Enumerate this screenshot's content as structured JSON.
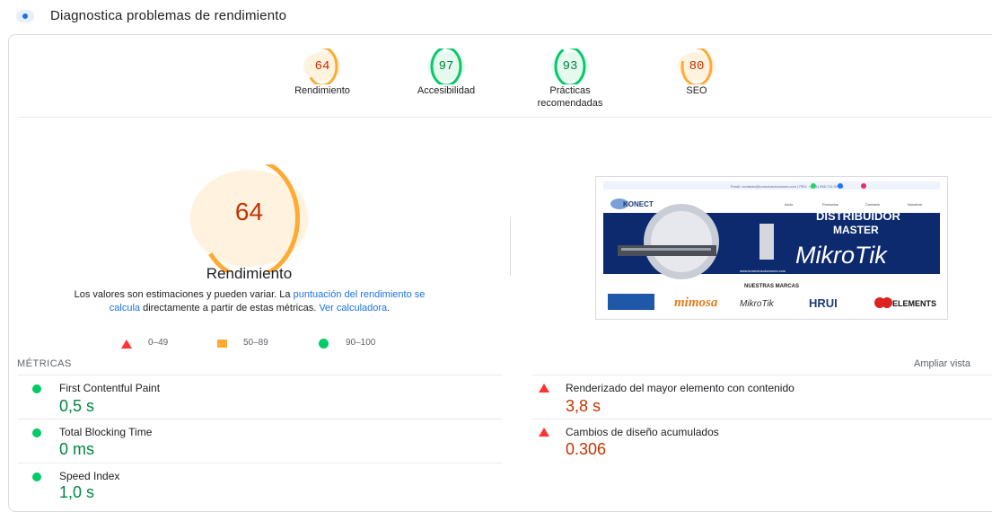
{
  "header": {
    "title": "Diagnostica problemas de rendimiento",
    "icon": "lighthouse-icon"
  },
  "colors": {
    "pass": "#0c6",
    "pass_text": "#018642",
    "average": "#fa3",
    "average_text": "#c33300",
    "fail": "#f33",
    "fail_text": "#c33300",
    "link": "#1a73e8"
  },
  "scores": [
    {
      "value": "64",
      "label": "Rendimiento",
      "percent": 64,
      "status": "average"
    },
    {
      "value": "97",
      "label": "Accesibilidad",
      "percent": 97,
      "status": "pass"
    },
    {
      "value": "93",
      "label_line1": "Prácticas",
      "label_line2": "recomendadas",
      "percent": 93,
      "status": "pass"
    },
    {
      "value": "80",
      "label": "SEO",
      "percent": 80,
      "status": "average"
    }
  ],
  "performance": {
    "score": "64",
    "percent": 64,
    "title": "Rendimiento",
    "desc_part1": "Los valores son estimaciones y pueden variar. La ",
    "desc_link1": "puntuación del rendimiento se calcula",
    "desc_part2": " directamente a partir de estas métricas. ",
    "desc_link2": "Ver calculadora",
    "desc_part3": "."
  },
  "legend": {
    "fail": "0–49",
    "average": "50–89",
    "pass": "90–100"
  },
  "screenshot": {
    "contact_bar": "Email: contacto@konectosoluciones.com  |  PBX: +(601) 555 711 0010  |",
    "brand": "KONECT",
    "nav": [
      "Inicio",
      "Productos",
      "Contacto",
      "Nosotros"
    ],
    "banner_line1": "DISTRIBUIDOR",
    "banner_line2": "MASTER",
    "banner_brand": "MikroTik",
    "url": "www.konectosoluciones.com",
    "brands_title": "NUESTRAS MARCAS",
    "brands": [
      "mimosa",
      "MikroTik",
      "HRUI",
      "ELEMENTS"
    ]
  },
  "metrics": {
    "title": "MÉTRICAS",
    "expand_label": "Ampliar vista",
    "items": [
      {
        "name": "First Contentful Paint",
        "value": "0,5 s",
        "status": "pass"
      },
      {
        "name": "Renderizado del mayor elemento con contenido",
        "value": "3,8 s",
        "status": "fail"
      },
      {
        "name": "Total Blocking Time",
        "value": "0 ms",
        "status": "pass"
      },
      {
        "name": "Cambios de diseño acumulados",
        "value": "0.306",
        "status": "fail"
      },
      {
        "name": "Speed Index",
        "value": "1,0 s",
        "status": "pass"
      }
    ]
  }
}
